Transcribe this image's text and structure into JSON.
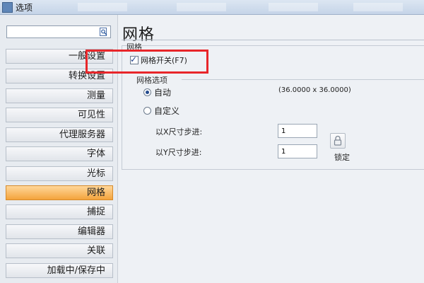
{
  "window": {
    "title": "选项"
  },
  "search": {
    "placeholder": ""
  },
  "sidebar": {
    "items": [
      {
        "label": "一般设置"
      },
      {
        "label": "转换设置"
      },
      {
        "label": "测量"
      },
      {
        "label": "可见性"
      },
      {
        "label": "代理服务器"
      },
      {
        "label": "字体"
      },
      {
        "label": "光标"
      },
      {
        "label": "网格",
        "active": true
      },
      {
        "label": "捕捉"
      },
      {
        "label": "编辑器"
      },
      {
        "label": "关联"
      },
      {
        "label": "加载中/保存中"
      }
    ]
  },
  "main": {
    "title": "网格",
    "group_title": "网格",
    "grid_toggle": {
      "label": "网格开关(F7)",
      "checked": true
    },
    "options_title": "网格选项",
    "auto": {
      "label": "自动",
      "selected": true,
      "size": "(36.0000 x 36.0000)"
    },
    "custom": {
      "label": "自定义",
      "selected": false
    },
    "x_step": {
      "label": "以X尺寸步进:",
      "value": "1"
    },
    "y_step": {
      "label": "以Y尺寸步进:",
      "value": "1"
    },
    "lock": {
      "label": "锁定"
    }
  },
  "colors": {
    "active_nav": "#f4a33c",
    "highlight": "#e8262a"
  },
  "icons": {
    "search": "search-icon",
    "lock": "lock-icon",
    "check": "check-icon"
  }
}
